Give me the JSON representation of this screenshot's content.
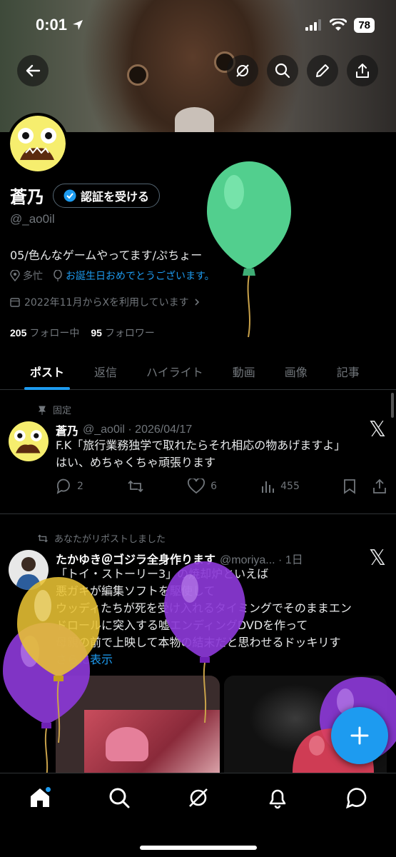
{
  "status_bar": {
    "time": "0:01",
    "battery": "78"
  },
  "profile": {
    "name": "蒼乃",
    "verify_label": "認証を受ける",
    "handle": "@_ao0il",
    "bio": "05/色んなゲームやってます/ぷちょー",
    "location": "多忙",
    "birthday": "お誕生日おめでとうございます。",
    "joined": "2022年11月からXを利用しています",
    "following_count": "205",
    "following_label": "フォロー中",
    "followers_count": "95",
    "followers_label": "フォロワー"
  },
  "tabs": [
    {
      "label": "ポスト"
    },
    {
      "label": "返信"
    },
    {
      "label": "ハイライト"
    },
    {
      "label": "動画"
    },
    {
      "label": "画像"
    },
    {
      "label": "記事"
    }
  ],
  "pinned_post": {
    "context": "固定",
    "name": "蒼乃",
    "meta": "@_ao0il · 2026/04/17",
    "line1": "F.K「旅行業務独学で取れたらそれ相応の物あげますよ」",
    "line2": "はい、めちゃくちゃ頑張ります",
    "replies": "2",
    "likes": "6",
    "views": "455"
  },
  "repost": {
    "context": "あなたがリポストしました",
    "name": "たかゆき＠ゴジラ全身作ります",
    "meta": "@moriya... · 1日",
    "lines": [
      "「トイ・ストーリー3」の焼却炉といえば",
      "悪ガキが編集ソフトを駆使して",
      "ウッディたちが死を受け入れるタイミングでそのままエン",
      "ドロールに突入する嘘エンディングDVDを作って",
      "母親の前で上映して本物の結末だと思わせるドッキリす"
    ],
    "show_more": "さらに表示"
  },
  "colors": {
    "accent": "#1d9bf0",
    "background": "#000000",
    "muted": "#71767b"
  }
}
